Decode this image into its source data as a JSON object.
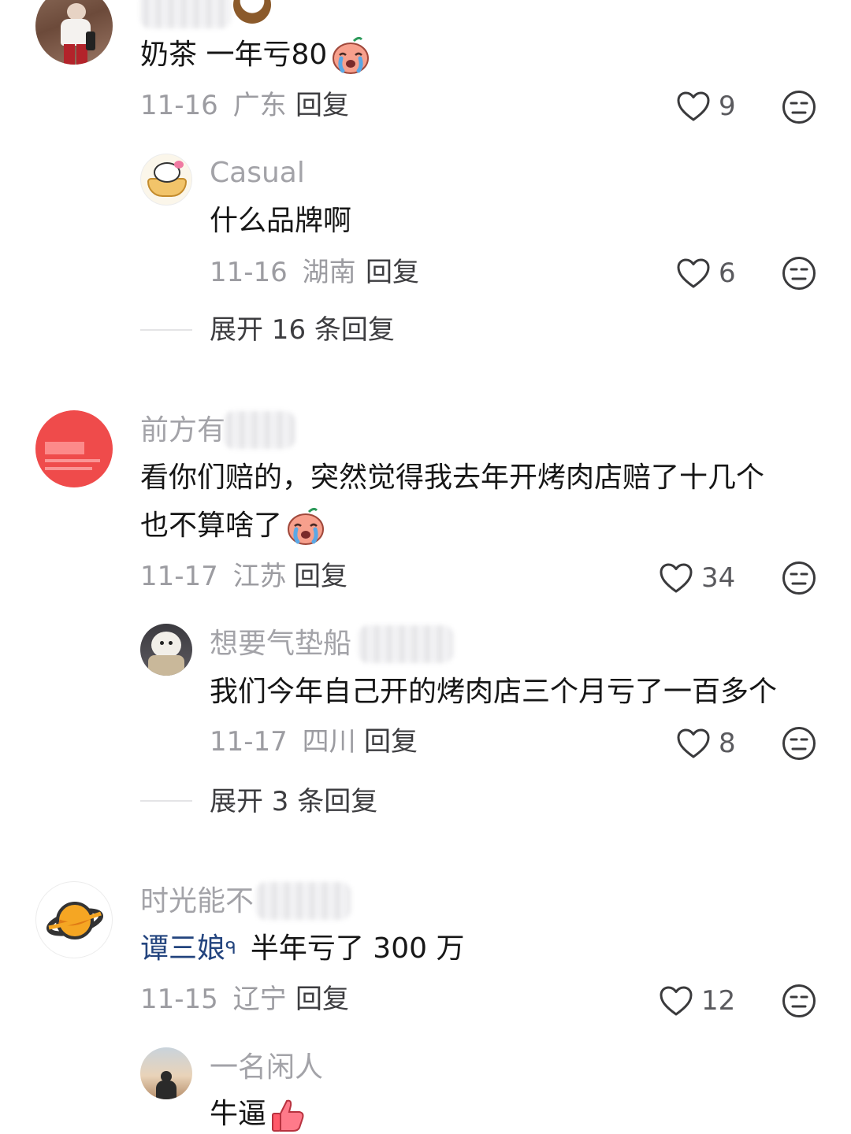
{
  "comments": [
    {
      "text": "奶茶 一年亏80",
      "date": "11-16",
      "region": "广东",
      "reply_label": "回复",
      "likes": "9",
      "emoji": "crying-face-emoji",
      "replies": [
        {
          "username": "Casual",
          "text": "什么品牌啊",
          "date": "11-16",
          "region": "湖南",
          "reply_label": "回复",
          "likes": "6"
        }
      ],
      "expand_label": "展开 16 条回复"
    },
    {
      "username": "前方有",
      "text_line1": "看你们赔的，突然觉得我去年开烤肉店赔了十几个",
      "text_line2": "也不算啥了",
      "date": "11-17",
      "region": "江苏",
      "reply_label": "回复",
      "likes": "34",
      "emoji": "crying-face-emoji",
      "replies": [
        {
          "username": "想要气垫船",
          "text": "我们今年自己开的烤肉店三个月亏了一百多个",
          "date": "11-17",
          "region": "四川",
          "reply_label": "回复",
          "likes": "8"
        }
      ],
      "expand_label": "展开 3 条回复"
    },
    {
      "username": "时光能不",
      "mention": "谭三娘",
      "text": "半年亏了 300 万",
      "date": "11-15",
      "region": "辽宁",
      "reply_label": "回复",
      "likes": "12",
      "replies": [
        {
          "username": "一名闲人",
          "text": "牛逼",
          "emoji": "thumbs-up-emoji"
        }
      ]
    }
  ],
  "colors": {
    "username": "#a3a3a8",
    "meta": "#9c9ca1",
    "mention": "#23447e",
    "text": "#161616"
  }
}
